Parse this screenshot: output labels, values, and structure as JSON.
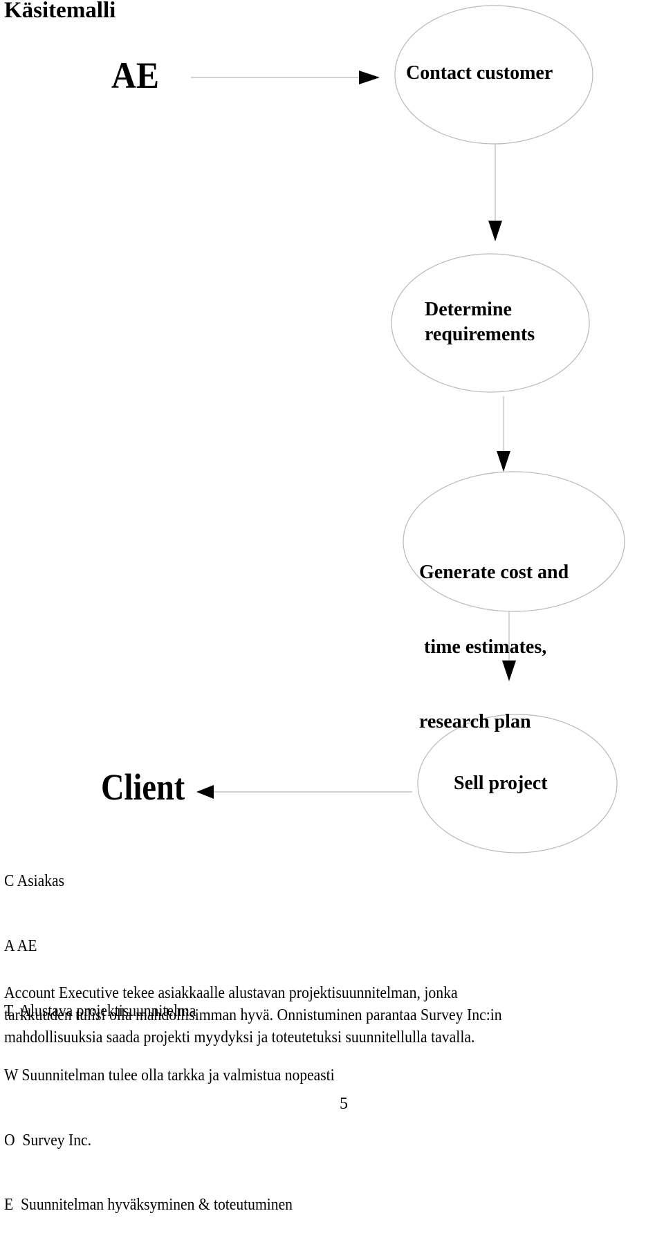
{
  "page": {
    "title": "Käsitemalli",
    "page_number": "5"
  },
  "diagram": {
    "actors": {
      "start": "AE",
      "end": "Client"
    },
    "nodes": [
      {
        "id": "contact",
        "lines": [
          "Contact customer"
        ]
      },
      {
        "id": "requirements",
        "lines": [
          "Determine",
          "requirements"
        ]
      },
      {
        "id": "estimates",
        "lines": [
          "Generate cost and",
          " time estimates,",
          "research plan"
        ]
      },
      {
        "id": "sell",
        "lines": [
          "Sell project"
        ]
      }
    ],
    "edges": [
      {
        "from": "AE",
        "to": "contact"
      },
      {
        "from": "contact",
        "to": "requirements"
      },
      {
        "from": "requirements",
        "to": "estimates"
      },
      {
        "from": "estimates",
        "to": "sell"
      },
      {
        "from": "sell",
        "to": "Client"
      }
    ],
    "colors": {
      "outline": "#b8b8b8",
      "arrowhead": "#000000"
    }
  },
  "catwoe": [
    {
      "key": "C",
      "value": "Asiakas"
    },
    {
      "key": "A",
      "value": "AE"
    },
    {
      "key": "T",
      "value": " Alustava projektisuunnitelma"
    },
    {
      "key": "W",
      "value": "Suunnitelman tulee olla tarkka ja valmistua nopeasti"
    },
    {
      "key": "O",
      "value": " Survey Inc."
    },
    {
      "key": "E",
      "value": " Suunnitelman hyväksyminen & toteutuminen"
    }
  ],
  "paragraph": [
    "Account Executive tekee asiakkaalle alustavan projektisuunnitelman, jonka",
    "tarkkuuden tulisi olla mahdollisimman hyvä. Onnistuminen parantaa Survey Inc:in",
    "mahdollisuuksia saada projekti myydyksi ja toteutetuksi suunnitellulla tavalla."
  ]
}
